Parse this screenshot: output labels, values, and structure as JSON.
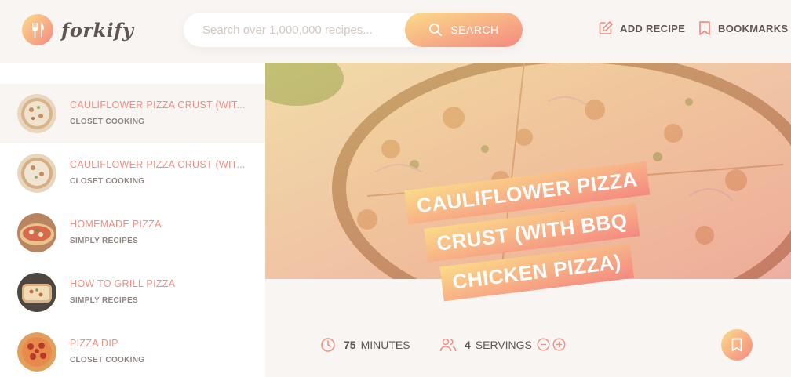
{
  "app": {
    "logo_text": "forkify"
  },
  "search": {
    "placeholder": "Search over 1,000,000 recipes...",
    "button_label": "SEARCH"
  },
  "nav": {
    "add_recipe": "ADD RECIPE",
    "bookmarks": "BOOKMARKS"
  },
  "results": [
    {
      "title": "CAULIFLOWER PIZZA CRUST (WIT...",
      "publisher": "CLOSET COOKING",
      "active": true
    },
    {
      "title": "CAULIFLOWER PIZZA CRUST (WIT...",
      "publisher": "CLOSET COOKING",
      "active": false
    },
    {
      "title": "HOMEMADE PIZZA",
      "publisher": "SIMPLY RECIPES",
      "active": false
    },
    {
      "title": "HOW TO GRILL PIZZA",
      "publisher": "SIMPLY RECIPES",
      "active": false
    },
    {
      "title": "PIZZA DIP",
      "publisher": "CLOSET COOKING",
      "active": false
    }
  ],
  "recipe": {
    "title_lines": [
      "CAULIFLOWER PIZZA",
      "CRUST (WITH BBQ",
      "CHICKEN PIZZA)"
    ],
    "cooking_time": "75",
    "cooking_time_unit": "MINUTES",
    "servings": "4",
    "servings_unit": "SERVINGS"
  },
  "colors": {
    "accent_start": "#fbdb89",
    "accent_end": "#f48982",
    "text": "#615551",
    "bg": "#f9f5f3"
  }
}
